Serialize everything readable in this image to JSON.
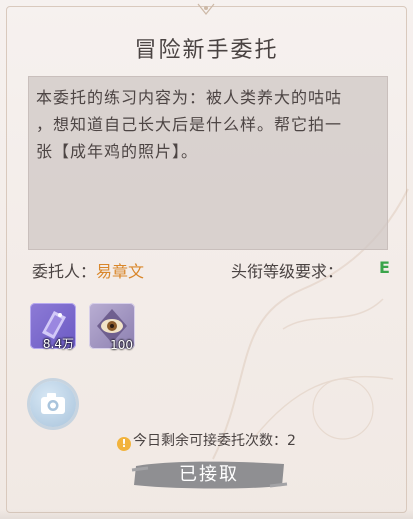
{
  "dialog": {
    "title": "冒险新手委托",
    "description": "本委托的练习内容为：被人类养大的咕咕\n，想知道自己长大后是什么样。帮它拍一\n张【成年鸡的照片】。",
    "client_label": "委托人：",
    "client_name": "易章文",
    "requirement_label": "头衔等级要求：",
    "requirement_value": "E",
    "rewards": [
      {
        "icon": "purple-ticket-icon",
        "count": "8.4万"
      },
      {
        "icon": "eye-badge-icon",
        "count": "100"
      }
    ],
    "camera_icon": "camera-icon",
    "remaining_text": "今日剩余可接委托次数：2",
    "accept_label": "已接取"
  },
  "colors": {
    "client_name": "#d9872b",
    "requirement": "#3aa44a",
    "warning": "#f2b33c"
  }
}
